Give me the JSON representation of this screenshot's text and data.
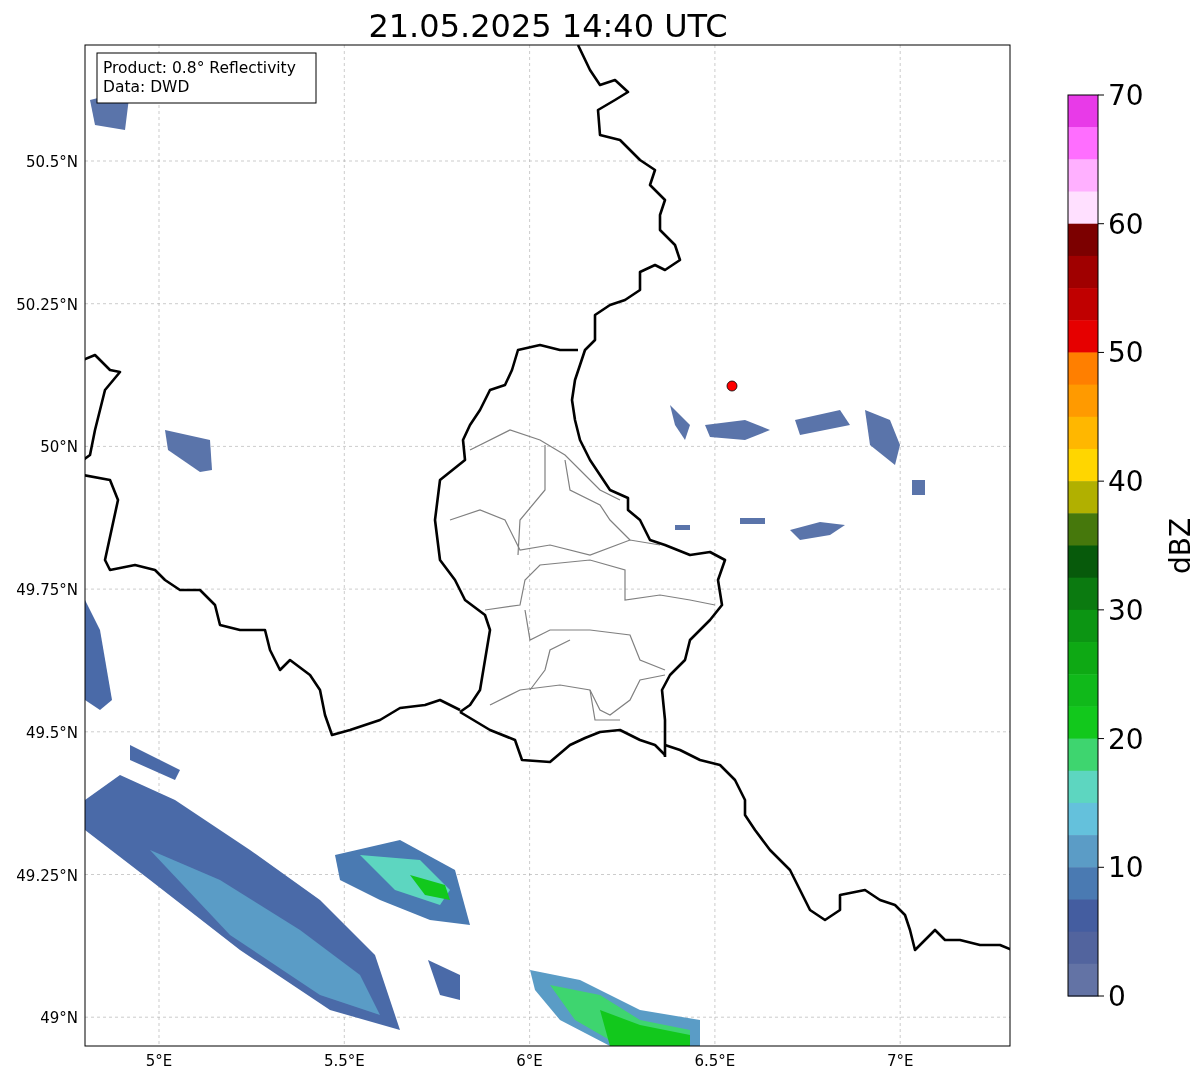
{
  "title": "21.05.2025 14:40 UTC",
  "info_box": [
    "Product: 0.8° Reflectivity",
    "Data: DWD"
  ],
  "map": {
    "xticks": [
      "5°E",
      "5.5°E",
      "6°E",
      "6.5°E",
      "7°E"
    ],
    "yticks": [
      "50.5°N",
      "50.25°N",
      "50°N",
      "49.75°N",
      "49.5°N",
      "49.25°N",
      "49°N"
    ]
  },
  "colorbar": {
    "label": "dBZ",
    "ticks": [
      "70",
      "60",
      "50",
      "40",
      "30",
      "20",
      "10",
      "0"
    ],
    "bands": [
      {
        "color": "#e83ae8"
      },
      {
        "color": "#ff6eff"
      },
      {
        "color": "#ffb0ff"
      },
      {
        "color": "#ffe0ff"
      },
      {
        "color": "#7c0000"
      },
      {
        "color": "#a00000"
      },
      {
        "color": "#c00000"
      },
      {
        "color": "#e60000"
      },
      {
        "color": "#ff7f00"
      },
      {
        "color": "#ff9a00"
      },
      {
        "color": "#ffb700"
      },
      {
        "color": "#ffd600"
      },
      {
        "color": "#b1b000"
      },
      {
        "color": "#46780c"
      },
      {
        "color": "#075a0b"
      },
      {
        "color": "#0b7a10"
      },
      {
        "color": "#0c9513"
      },
      {
        "color": "#0ea914"
      },
      {
        "color": "#10b91a"
      },
      {
        "color": "#12c81c"
      },
      {
        "color": "#3ed56f"
      },
      {
        "color": "#5dd6c0"
      },
      {
        "color": "#64c1dc"
      },
      {
        "color": "#5b9cc6"
      },
      {
        "color": "#4a7ab2"
      },
      {
        "color": "#445da0"
      },
      {
        "color": "#52649e"
      },
      {
        "color": "#6373a5"
      }
    ]
  }
}
